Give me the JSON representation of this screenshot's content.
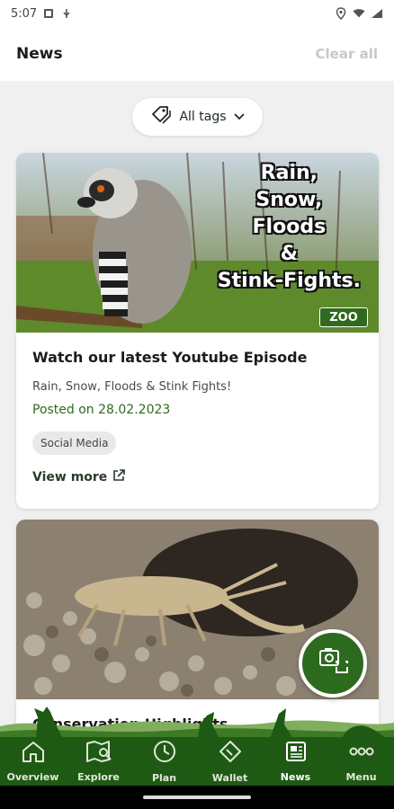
{
  "status_bar": {
    "time": "5:07"
  },
  "header": {
    "title": "News",
    "clear_label": "Clear all"
  },
  "filter": {
    "label": "All tags"
  },
  "cards": [
    {
      "promo_lines": [
        "Rain,",
        "Snow,",
        "Floods",
        "&",
        "Stink-Fights."
      ],
      "logo_text": "ZOO",
      "title": "Watch our latest Youtube Episode",
      "subtitle": "Rain, Snow, Floods & Stink Fights!",
      "date": "Posted on 28.02.2023",
      "badge": "Social Media",
      "view_more": "View more"
    },
    {
      "title": "Conservation Highlights"
    }
  ],
  "nav": {
    "items": [
      {
        "label": "Overview",
        "icon": "home-icon"
      },
      {
        "label": "Explore",
        "icon": "map-icon"
      },
      {
        "label": "Plan",
        "icon": "clock-icon"
      },
      {
        "label": "Wallet",
        "icon": "ticket-icon"
      },
      {
        "label": "News",
        "icon": "newspaper-icon"
      },
      {
        "label": "Menu",
        "icon": "more-icon"
      }
    ]
  },
  "colors": {
    "brand_green": "#1f5a14",
    "accent_green": "#2c6a1e",
    "date_green": "#2f6a1f"
  }
}
